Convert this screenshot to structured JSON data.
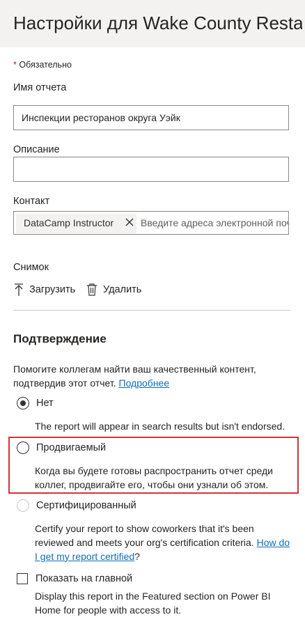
{
  "header": {
    "title": "Настройки для Wake County Restaurant Inspections"
  },
  "form": {
    "required_star": "*",
    "required_note": "Обязательно",
    "report_name": {
      "label": "Имя отчета",
      "value": "Инспекции ресторанов округа Уэйк"
    },
    "description": {
      "label": "Описание",
      "value": ""
    },
    "contact": {
      "label": "Контакт",
      "chip": "DataCamp Instructor",
      "placeholder": "Введите адреса электронной почты"
    },
    "snapshot": {
      "label": "Снимок",
      "upload": "Загрузить",
      "delete": "Удалить"
    }
  },
  "endorsement": {
    "title": "Подтверждение",
    "intro": "Помогите коллегам найти ваш качественный контент, подтвердив этот отчет.",
    "learn_more": "Подробнее",
    "options": {
      "none": {
        "label": "Нет",
        "selected": true,
        "description": "The report will appear in search results but isn't endorsed."
      },
      "promoted": {
        "label": "Продвигаемый",
        "selected": false,
        "description": "Когда вы будете готовы распространить отчет среди коллег, продвигайте его, чтобы они узнали об этом."
      },
      "certified": {
        "label": "Сертифицированный",
        "selected": false,
        "disabled": true,
        "description": "Certify your report to show coworkers that it's been reviewed and meets your org's certification criteria.",
        "link": "How do I get my report certified",
        "suffix": "?"
      }
    }
  },
  "featured": {
    "label": "Показать на главной",
    "checked": false,
    "description": "Display this report in the Featured section on Power BI Home for people with access to it."
  },
  "colors": {
    "link": "#0f6cbd",
    "highlight": "#d13438",
    "required": "#a4262c",
    "header_bg": "#f3f2f1"
  }
}
